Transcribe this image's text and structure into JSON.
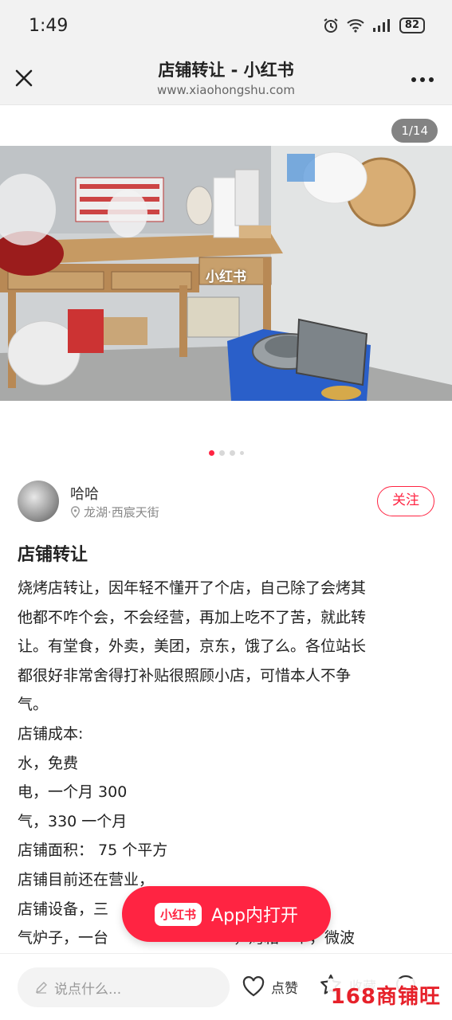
{
  "status_bar": {
    "time": "1:49",
    "battery": "82"
  },
  "nav": {
    "title": "店铺转让 - 小红书",
    "subtitle": "www.xiaohongshu.com"
  },
  "carousel": {
    "counter": "1/14",
    "watermark": "小红书",
    "current_index": 1,
    "total": 14
  },
  "author": {
    "name": "哈哈",
    "location": "龙湖·西宸天街",
    "follow_label": "关注"
  },
  "note": {
    "title": "店铺转让",
    "lines": [
      "烧烤店转让，因年轻不懂开了个店，自己除了会烤其",
      "他都不咋个会，不会经营，再加上吃不了苦，就此转",
      "让。有堂食，外卖，美团，京东，饿了么。各位站长",
      "都很好非常舍得打补贴很照顾小店，可惜本人不争",
      "气。",
      "店铺成本:",
      "水，免费",
      "电，一个月 300",
      "气，330 一个月",
      "店铺面积： 75 个平方",
      "店铺目前还在营业，",
      "店铺设备，三                          展示柜，两台",
      "气炉子，一台                          ，烤箱一个，微波"
    ]
  },
  "open_app": {
    "logo": "小红书",
    "label": "App内打开"
  },
  "bottom_bar": {
    "comment_placeholder": "说点什么...",
    "like_label": "点赞",
    "collect_label": "收藏"
  },
  "site_watermark": "168商铺旺",
  "colors": {
    "accent": "#ff2442",
    "background": "#ffffff",
    "header_bg": "#f2f2f2"
  }
}
